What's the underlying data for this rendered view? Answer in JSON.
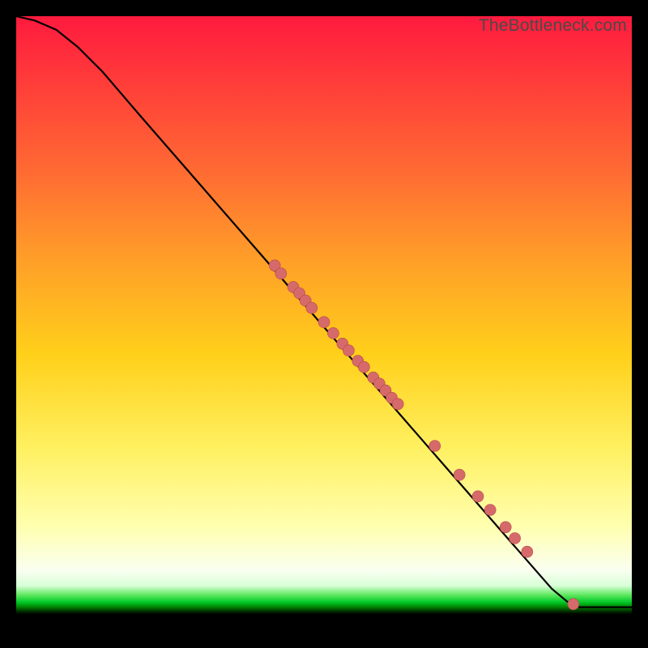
{
  "watermark": "TheBottleneck.com",
  "colors": {
    "dot_fill": "#d66a6a",
    "dot_stroke": "#b84848",
    "curve": "#000000",
    "frame": "#000000"
  },
  "chart_data": {
    "type": "line",
    "title": "",
    "xlabel": "",
    "ylabel": "",
    "xlim": [
      0,
      100
    ],
    "ylim": [
      0,
      100
    ],
    "grid": false,
    "legend": false,
    "curve": [
      {
        "x": 0.0,
        "y": 100.0
      },
      {
        "x": 3.0,
        "y": 99.3
      },
      {
        "x": 6.5,
        "y": 97.8
      },
      {
        "x": 10.0,
        "y": 95.0
      },
      {
        "x": 14.0,
        "y": 91.0
      },
      {
        "x": 20.0,
        "y": 84.0
      },
      {
        "x": 30.0,
        "y": 72.5
      },
      {
        "x": 40.0,
        "y": 61.0
      },
      {
        "x": 50.0,
        "y": 49.5
      },
      {
        "x": 60.0,
        "y": 38.0
      },
      {
        "x": 70.0,
        "y": 26.5
      },
      {
        "x": 80.0,
        "y": 15.0
      },
      {
        "x": 87.0,
        "y": 7.0
      },
      {
        "x": 90.0,
        "y": 4.5
      },
      {
        "x": 91.5,
        "y": 4.0
      },
      {
        "x": 100.0,
        "y": 4.0
      }
    ],
    "scatter": [
      {
        "x": 42.0,
        "y": 59.5
      },
      {
        "x": 43.0,
        "y": 58.2
      },
      {
        "x": 45.0,
        "y": 56.0
      },
      {
        "x": 46.0,
        "y": 55.0
      },
      {
        "x": 47.0,
        "y": 53.8
      },
      {
        "x": 48.0,
        "y": 52.6
      },
      {
        "x": 50.0,
        "y": 50.3
      },
      {
        "x": 51.5,
        "y": 48.5
      },
      {
        "x": 53.0,
        "y": 46.8
      },
      {
        "x": 54.0,
        "y": 45.7
      },
      {
        "x": 55.5,
        "y": 44.0
      },
      {
        "x": 56.5,
        "y": 43.0
      },
      {
        "x": 58.0,
        "y": 41.3
      },
      {
        "x": 59.0,
        "y": 40.3
      },
      {
        "x": 60.0,
        "y": 39.2
      },
      {
        "x": 61.0,
        "y": 38.0
      },
      {
        "x": 62.0,
        "y": 37.0
      },
      {
        "x": 68.0,
        "y": 30.2
      },
      {
        "x": 72.0,
        "y": 25.5
      },
      {
        "x": 75.0,
        "y": 22.0
      },
      {
        "x": 77.0,
        "y": 19.8
      },
      {
        "x": 79.5,
        "y": 17.0
      },
      {
        "x": 81.0,
        "y": 15.2
      },
      {
        "x": 83.0,
        "y": 13.0
      },
      {
        "x": 90.5,
        "y": 4.5
      }
    ],
    "dot_radius_px": 7
  }
}
